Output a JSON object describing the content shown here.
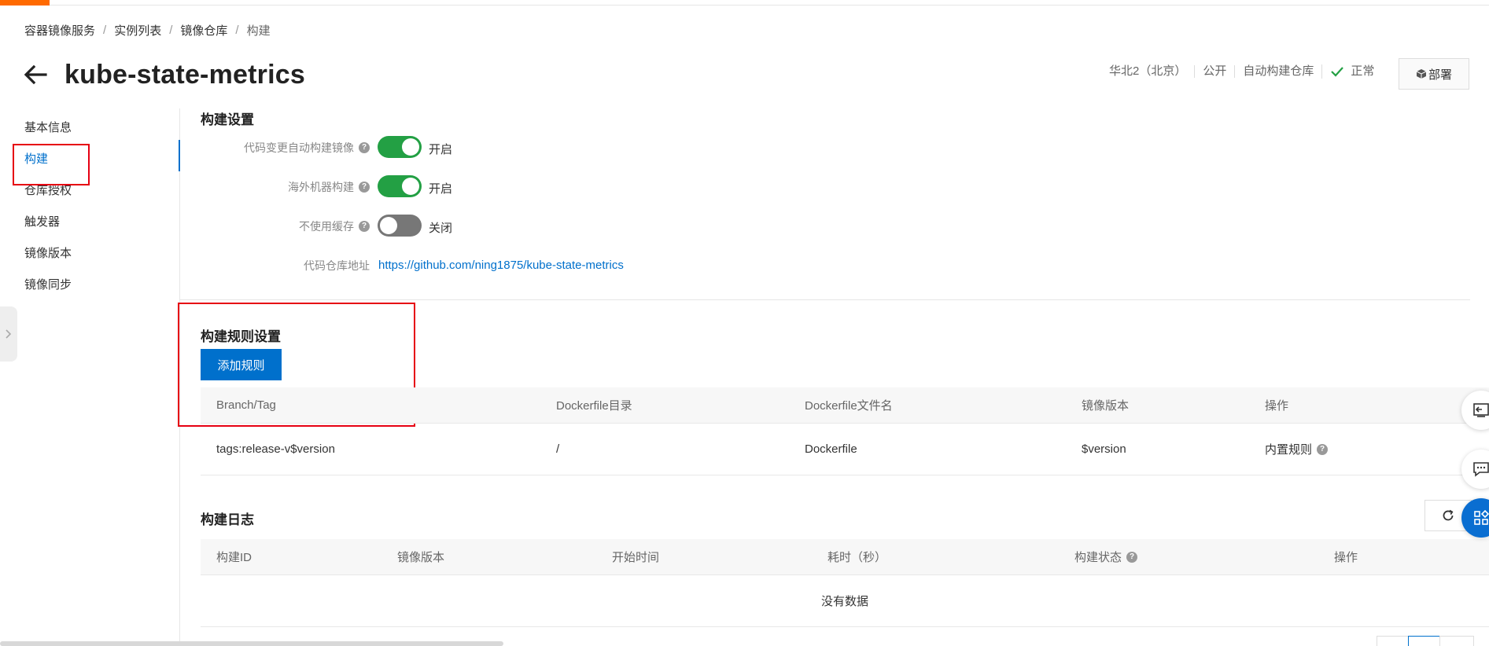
{
  "breadcrumb": {
    "items": [
      "容器镜像服务",
      "实例列表",
      "镜像仓库",
      "构建"
    ],
    "separator": "/"
  },
  "header": {
    "title": "kube-state-metrics",
    "region": "华北2（北京）",
    "visibility": "公开",
    "repo_type": "自动构建仓库",
    "status": "正常",
    "deploy_label": "部署"
  },
  "sidebar": {
    "items": [
      {
        "label": "基本信息"
      },
      {
        "label": "构建"
      },
      {
        "label": "仓库授权"
      },
      {
        "label": "触发器"
      },
      {
        "label": "镜像版本"
      },
      {
        "label": "镜像同步"
      }
    ],
    "active_index": 1
  },
  "build_settings": {
    "title": "构建设置",
    "auto_build": {
      "label": "代码变更自动构建镜像",
      "state": "开启",
      "on": true
    },
    "overseas": {
      "label": "海外机器构建",
      "state": "开启",
      "on": true
    },
    "no_cache": {
      "label": "不使用缓存",
      "state": "关闭",
      "on": false
    },
    "repo_url": {
      "label": "代码仓库地址",
      "value": "https://github.com/ning1875/kube-state-metrics"
    }
  },
  "build_rules": {
    "title": "构建规则设置",
    "add_button": "添加规则",
    "columns": [
      "Branch/Tag",
      "Dockerfile目录",
      "Dockerfile文件名",
      "镜像版本",
      "操作"
    ],
    "rows": [
      [
        "tags:release-v$version",
        "/",
        "Dockerfile",
        "$version",
        "内置规则"
      ]
    ]
  },
  "build_logs": {
    "title": "构建日志",
    "columns": [
      "构建ID",
      "镜像版本",
      "开始时间",
      "耗时（秒）",
      "构建状态",
      "操作"
    ],
    "empty_text": "没有数据"
  },
  "colors": {
    "brand_orange": "#ff6a00",
    "primary_blue": "#0070cc",
    "switch_on": "#23a044",
    "switch_off": "#777777",
    "annotation_red": "#e60012",
    "status_green": "#23a044"
  },
  "icons": {
    "back": "arrow-left-icon",
    "status": "check-icon",
    "deploy": "cube-icon",
    "help": "question-circle-icon",
    "refresh": "refresh-icon",
    "collapse": "chevron-right-icon",
    "float_1": "panel-left-icon",
    "float_2": "chat-icon",
    "float_3": "apps-grid-icon"
  }
}
